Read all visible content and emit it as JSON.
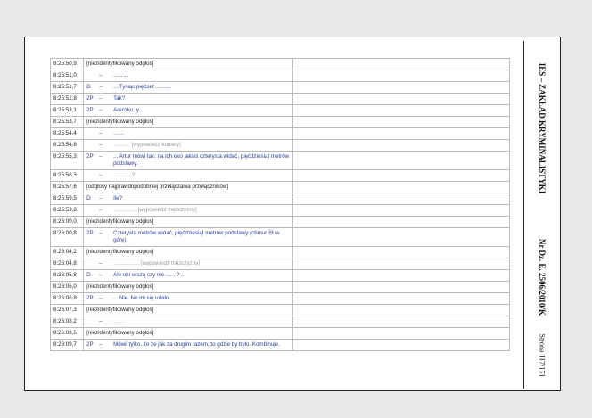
{
  "side": {
    "org": "IES – ZAKŁAD KRYMINALISTYKI",
    "doc_no": "Nr Dz. E. 2506/2010/K",
    "page": "Strona 117/171"
  },
  "rows": [
    {
      "time": "8:25:50,9",
      "note": "[niezidentyfikowany odgłos]"
    },
    {
      "time": "8:25:51,0",
      "spk": "",
      "dash": "–",
      "text": "...... ...",
      "style": "blue"
    },
    {
      "time": "8:25:51,7",
      "spk": "D",
      "dash": "–",
      "text": "... Tysiąc pięćset ..........",
      "style": "blue"
    },
    {
      "time": "8:25:52,8",
      "spk": "2P",
      "dash": "–",
      "text": "Tak?",
      "style": "blue"
    },
    {
      "time": "8:25:53,1",
      "spk": "2P",
      "dash": "–",
      "text": "Areczku, y...",
      "style": "blue"
    },
    {
      "time": "8:25:53,7",
      "note": "[niezidentyfikowany odgłos]"
    },
    {
      "time": "8:25:54,4",
      "spk": "",
      "dash": "–",
      "text": ".......",
      "style": "blue"
    },
    {
      "time": "8:25:54,8",
      "spk": "",
      "dash": "–",
      "text": "........... [wypowiedź kobiety]",
      "style": "grey"
    },
    {
      "time": "8:25:55,3",
      "spk": "2P",
      "dash": "–",
      "text": "... Artur mówi tak: na ich oko jakieś czterysta widać, pięćdziesiąt metrów podstawy.",
      "style": "blue"
    },
    {
      "time": "8:25:56,3",
      "spk": "",
      "dash": "–",
      "text": "............?",
      "style": "grey"
    },
    {
      "time": "8:25:57,6",
      "note": "[odgłosy najprawdopodobniej przełączania przełączników]"
    },
    {
      "time": "8:25:59,5",
      "spk": "D",
      "dash": "–",
      "text": "Ile?",
      "style": "blue"
    },
    {
      "time": "8:25:59,8",
      "spk": "",
      "dash": "–",
      "text": "............... [wypowiedź mężczyzny]",
      "style": "grey"
    },
    {
      "time": "8:26:00,0",
      "note": "[niezidentyfikowany odgłos]"
    },
    {
      "time": "8:26:00,8",
      "spk": "2P",
      "dash": "–",
      "text": "Czterysta metrów widać, pięćdziesiąt metrów podstawy (chmur Ⓜ w górę).",
      "style": "blue"
    },
    {
      "time": "8:26:04,2",
      "note": "[niezidentyfikowany odgłos]"
    },
    {
      "time": "8:26:04,8",
      "spk": "",
      "dash": "–",
      "text": "................. [wypowiedź mężczyzny]",
      "style": "grey"
    },
    {
      "time": "8:26:05,8",
      "spk": "D",
      "dash": "–",
      "text": "Ale oni wiszą czy nie ...... ? ...",
      "style": "blue"
    },
    {
      "time": "8:26:06,0",
      "note": "[niezidentyfikowany odgłos]"
    },
    {
      "time": "8:26:06,8",
      "spk": "2P",
      "dash": "–",
      "text": "... Nie. No im się udało.",
      "style": "blue"
    },
    {
      "time": "8:26:07,3",
      "note": "[niezidentyfikowany odgłos]"
    },
    {
      "time": "8:26:08,2",
      "spk": "",
      "dash": "–",
      "text": ".......",
      "style": "grey"
    },
    {
      "time": "8:26:08,6",
      "note": "[niezidentyfikowany odgłos]"
    },
    {
      "time": "8:26:09,7",
      "spk": "2P",
      "dash": "–",
      "text": "Mówił tylko, że że jak za drugim razem, to gdzie by było. Kombinuje.",
      "style": "blue"
    }
  ]
}
